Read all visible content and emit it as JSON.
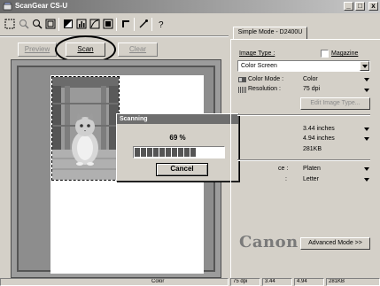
{
  "window": {
    "title": "ScanGear CS-U",
    "controls": [
      "_",
      "□",
      "x"
    ]
  },
  "toolbar": {
    "icons": [
      "select-all-icon",
      "zoom-icon",
      "magnify-icon",
      "crop-icon",
      "image-adjust-icon",
      "histogram-icon",
      "tone-curve-icon",
      "threshold-icon",
      "final-review-icon",
      "eyedropper-icon",
      "help-icon"
    ]
  },
  "actions": {
    "preview": "Preview",
    "scan": "Scan",
    "clear": "Clear"
  },
  "scan_dialog": {
    "title": "Scanning",
    "percent_text": "69 %",
    "progress": 0.69,
    "cancel_label": "Cancel"
  },
  "panel": {
    "tab_label": "Simple Mode - D2400U",
    "image_type_label": "Image Type :",
    "magazine_label": "Magazine",
    "image_type_value": "Color Screen",
    "color_mode_label": "Color Mode :",
    "color_mode_value": "Color",
    "resolution_label": "Resolution :",
    "resolution_value": "75 dpi",
    "edit_image_type": "Edit Image Type...",
    "width_value": "3.44 inches",
    "height_value": "4.94 inches",
    "filesize_value": "281KB",
    "source_label": "ce :",
    "source_value": "Platen",
    "size_label": ":",
    "size_value": "Letter",
    "brand": "Canon",
    "advanced_mode": "Advanced Mode >>"
  },
  "statusbar": {
    "color": "Color",
    "dpi": "75 dpi",
    "width": "3.44",
    "height": "4.94",
    "size": "281KB"
  }
}
